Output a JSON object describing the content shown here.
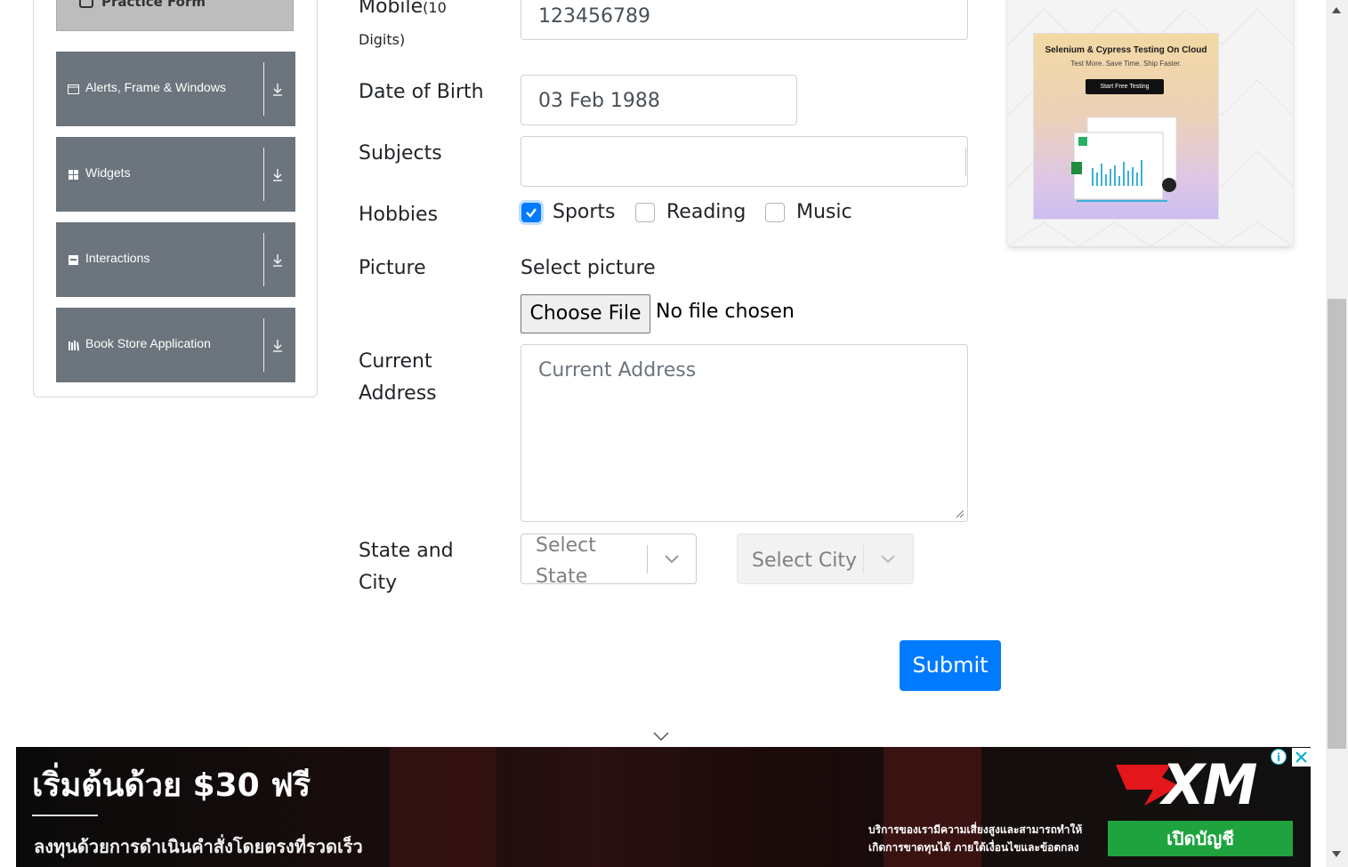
{
  "sidebar": {
    "practice_form_label": "Practice Form",
    "items": [
      {
        "label": "Alerts, Frame & Windows",
        "icon": "window-icon"
      },
      {
        "label": "Widgets",
        "icon": "widgets-grid-icon"
      },
      {
        "label": "Interactions",
        "icon": "interactions-icon"
      },
      {
        "label": "Book Store Application",
        "icon": "books-icon"
      }
    ]
  },
  "form": {
    "mobile_label": "Mobile",
    "mobile_note_1": "(10",
    "mobile_note_2": "Digits)",
    "mobile_value": "123456789",
    "dob_label": "Date of Birth",
    "dob_value": "03 Feb 1988",
    "subjects_label": "Subjects",
    "subjects_value": "",
    "hobbies_label": "Hobbies",
    "hobbies": [
      {
        "label": "Sports",
        "checked": true
      },
      {
        "label": "Reading",
        "checked": false
      },
      {
        "label": "Music",
        "checked": false
      }
    ],
    "picture_label": "Picture",
    "picture_prompt": "Select picture",
    "choose_file_label": "Choose File",
    "file_status": "No file chosen",
    "address_label_1": "Current",
    "address_label_2": "Address",
    "address_placeholder": "Current Address",
    "state_city_label_1": "State and",
    "state_city_label_2": "City",
    "state_placeholder_1": "Select",
    "state_placeholder_2": "State",
    "city_placeholder": "Select City",
    "submit_label": "Submit"
  },
  "side_ad": {
    "title": "Selenium & Cypress Testing On Cloud",
    "subtitle": "Test More. Save Time. Ship Faster.",
    "button": "Start Free Testing"
  },
  "bottom_ad": {
    "headline": "เริ่มต้นด้วย $30 ฟรี",
    "subline": "ลงทุนด้วยการดำเนินคำสั่งโดยตรงที่รวดเร็ว",
    "brand": "XM",
    "disclaimer_1": "บริการของเรามีความเสี่ยงสูงและสามารถทำให้",
    "disclaimer_2": "เกิดการขาดทุนได้ ภายใต้เงื่อนไขและข้อตกลง",
    "cta": "เปิดบัญชี",
    "info_glyph": "i"
  },
  "colors": {
    "primary": "#007bff",
    "sidebar_item": "#6c757d",
    "cta_green": "#1fa33f"
  }
}
